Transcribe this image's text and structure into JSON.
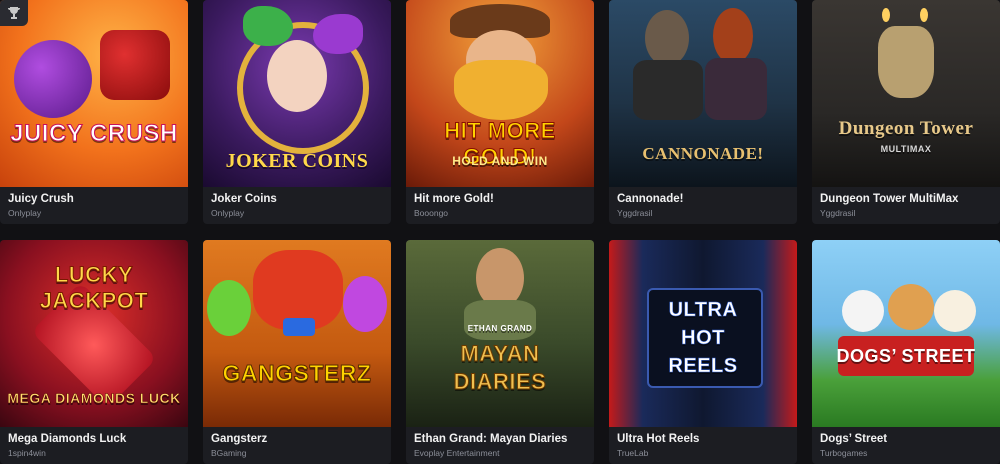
{
  "games": [
    {
      "title": "Juicy Crush",
      "provider": "Onlyplay",
      "art": "JUICY CRUSH",
      "bg": "#f2721c"
    },
    {
      "title": "Joker Coins",
      "provider": "Onlyplay",
      "art": "JOKER COINS",
      "bg": "#3a1a5e"
    },
    {
      "title": "Hit more Gold!",
      "provider": "Booongo",
      "art": "HIT MORE GOLD!",
      "art_sub": "HOLD AND WIN",
      "bg": "#c3471a"
    },
    {
      "title": "Cannonade!",
      "provider": "Yggdrasil",
      "art": "CANNONADE!",
      "bg": "#1f3346"
    },
    {
      "title": "Dungeon Tower MultiMax",
      "provider": "Yggdrasil",
      "art": "Dungeon Tower",
      "art_sub": "MULTIMAX",
      "bg": "#2a2826"
    },
    {
      "title": "Mega Diamonds Luck",
      "provider": "1spin4win",
      "art": "LUCKY JACKPOT",
      "art_sub": "MEGA DIAMONDS LUCK",
      "bg": "#8a1020"
    },
    {
      "title": "Gangsterz",
      "provider": "BGaming",
      "art": "GANGSTERZ",
      "bg": "#c45a10"
    },
    {
      "title": "Ethan Grand: Mayan Diaries",
      "provider": "Evoplay Entertainment",
      "art": "MAYAN DIARIES",
      "art_sub": "ETHAN GRAND",
      "bg": "#3a4a2a"
    },
    {
      "title": "Ultra Hot Reels",
      "provider": "TrueLab",
      "art": "ULTRA HOT REELS",
      "bg": "#0f1830"
    },
    {
      "title": "Dogs’ Street",
      "provider": "Turbogames",
      "art": "DOGS’ STREET",
      "bg": "#6fb8e6"
    }
  ],
  "icons": {
    "tournament": "trophy-icon"
  }
}
